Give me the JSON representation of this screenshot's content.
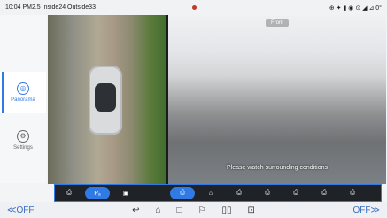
{
  "status": {
    "left_text": "10:04  PM2.5 Inside24  Outside33",
    "right_text": "⊕ ✦ ▮ ◉ ⊙ ◢ ⊿ 0°"
  },
  "sidebar": {
    "items": [
      {
        "label": "Panorama",
        "icon": "camera-circle-icon",
        "active": true
      },
      {
        "label": "Settings",
        "icon": "gear-icon",
        "active": false
      }
    ]
  },
  "camera": {
    "front_label": "Front",
    "hint": "Please watch surrounding conditions"
  },
  "toolbar": {
    "buttons": [
      {
        "icon": "car-rear-icon",
        "label": "⎙",
        "active": false
      },
      {
        "icon": "parking-auto-icon",
        "label": "Pₐ",
        "active": true
      },
      {
        "icon": "camera-icon",
        "label": "▣",
        "active": false
      },
      {
        "icon": "car-front-view-icon",
        "label": "⎙",
        "active": true
      },
      {
        "icon": "car-side-icon",
        "label": "⌂",
        "active": false
      },
      {
        "icon": "car-left-icon",
        "label": "⎙",
        "active": false
      },
      {
        "icon": "car-right-icon",
        "label": "⎙",
        "active": false
      },
      {
        "icon": "car-3d-icon",
        "label": "⎙",
        "active": false
      },
      {
        "icon": "car-top-icon",
        "label": "⎙",
        "active": false
      },
      {
        "icon": "car-rear-view-icon",
        "label": "⎙",
        "active": false
      }
    ]
  },
  "navbar": {
    "left": "≪OFF",
    "right": "OFF≫",
    "icons": [
      "↩",
      "⌂",
      "□",
      "⚐",
      "▯▯",
      "⊡"
    ]
  },
  "colors": {
    "accent": "#2f7ae5"
  }
}
